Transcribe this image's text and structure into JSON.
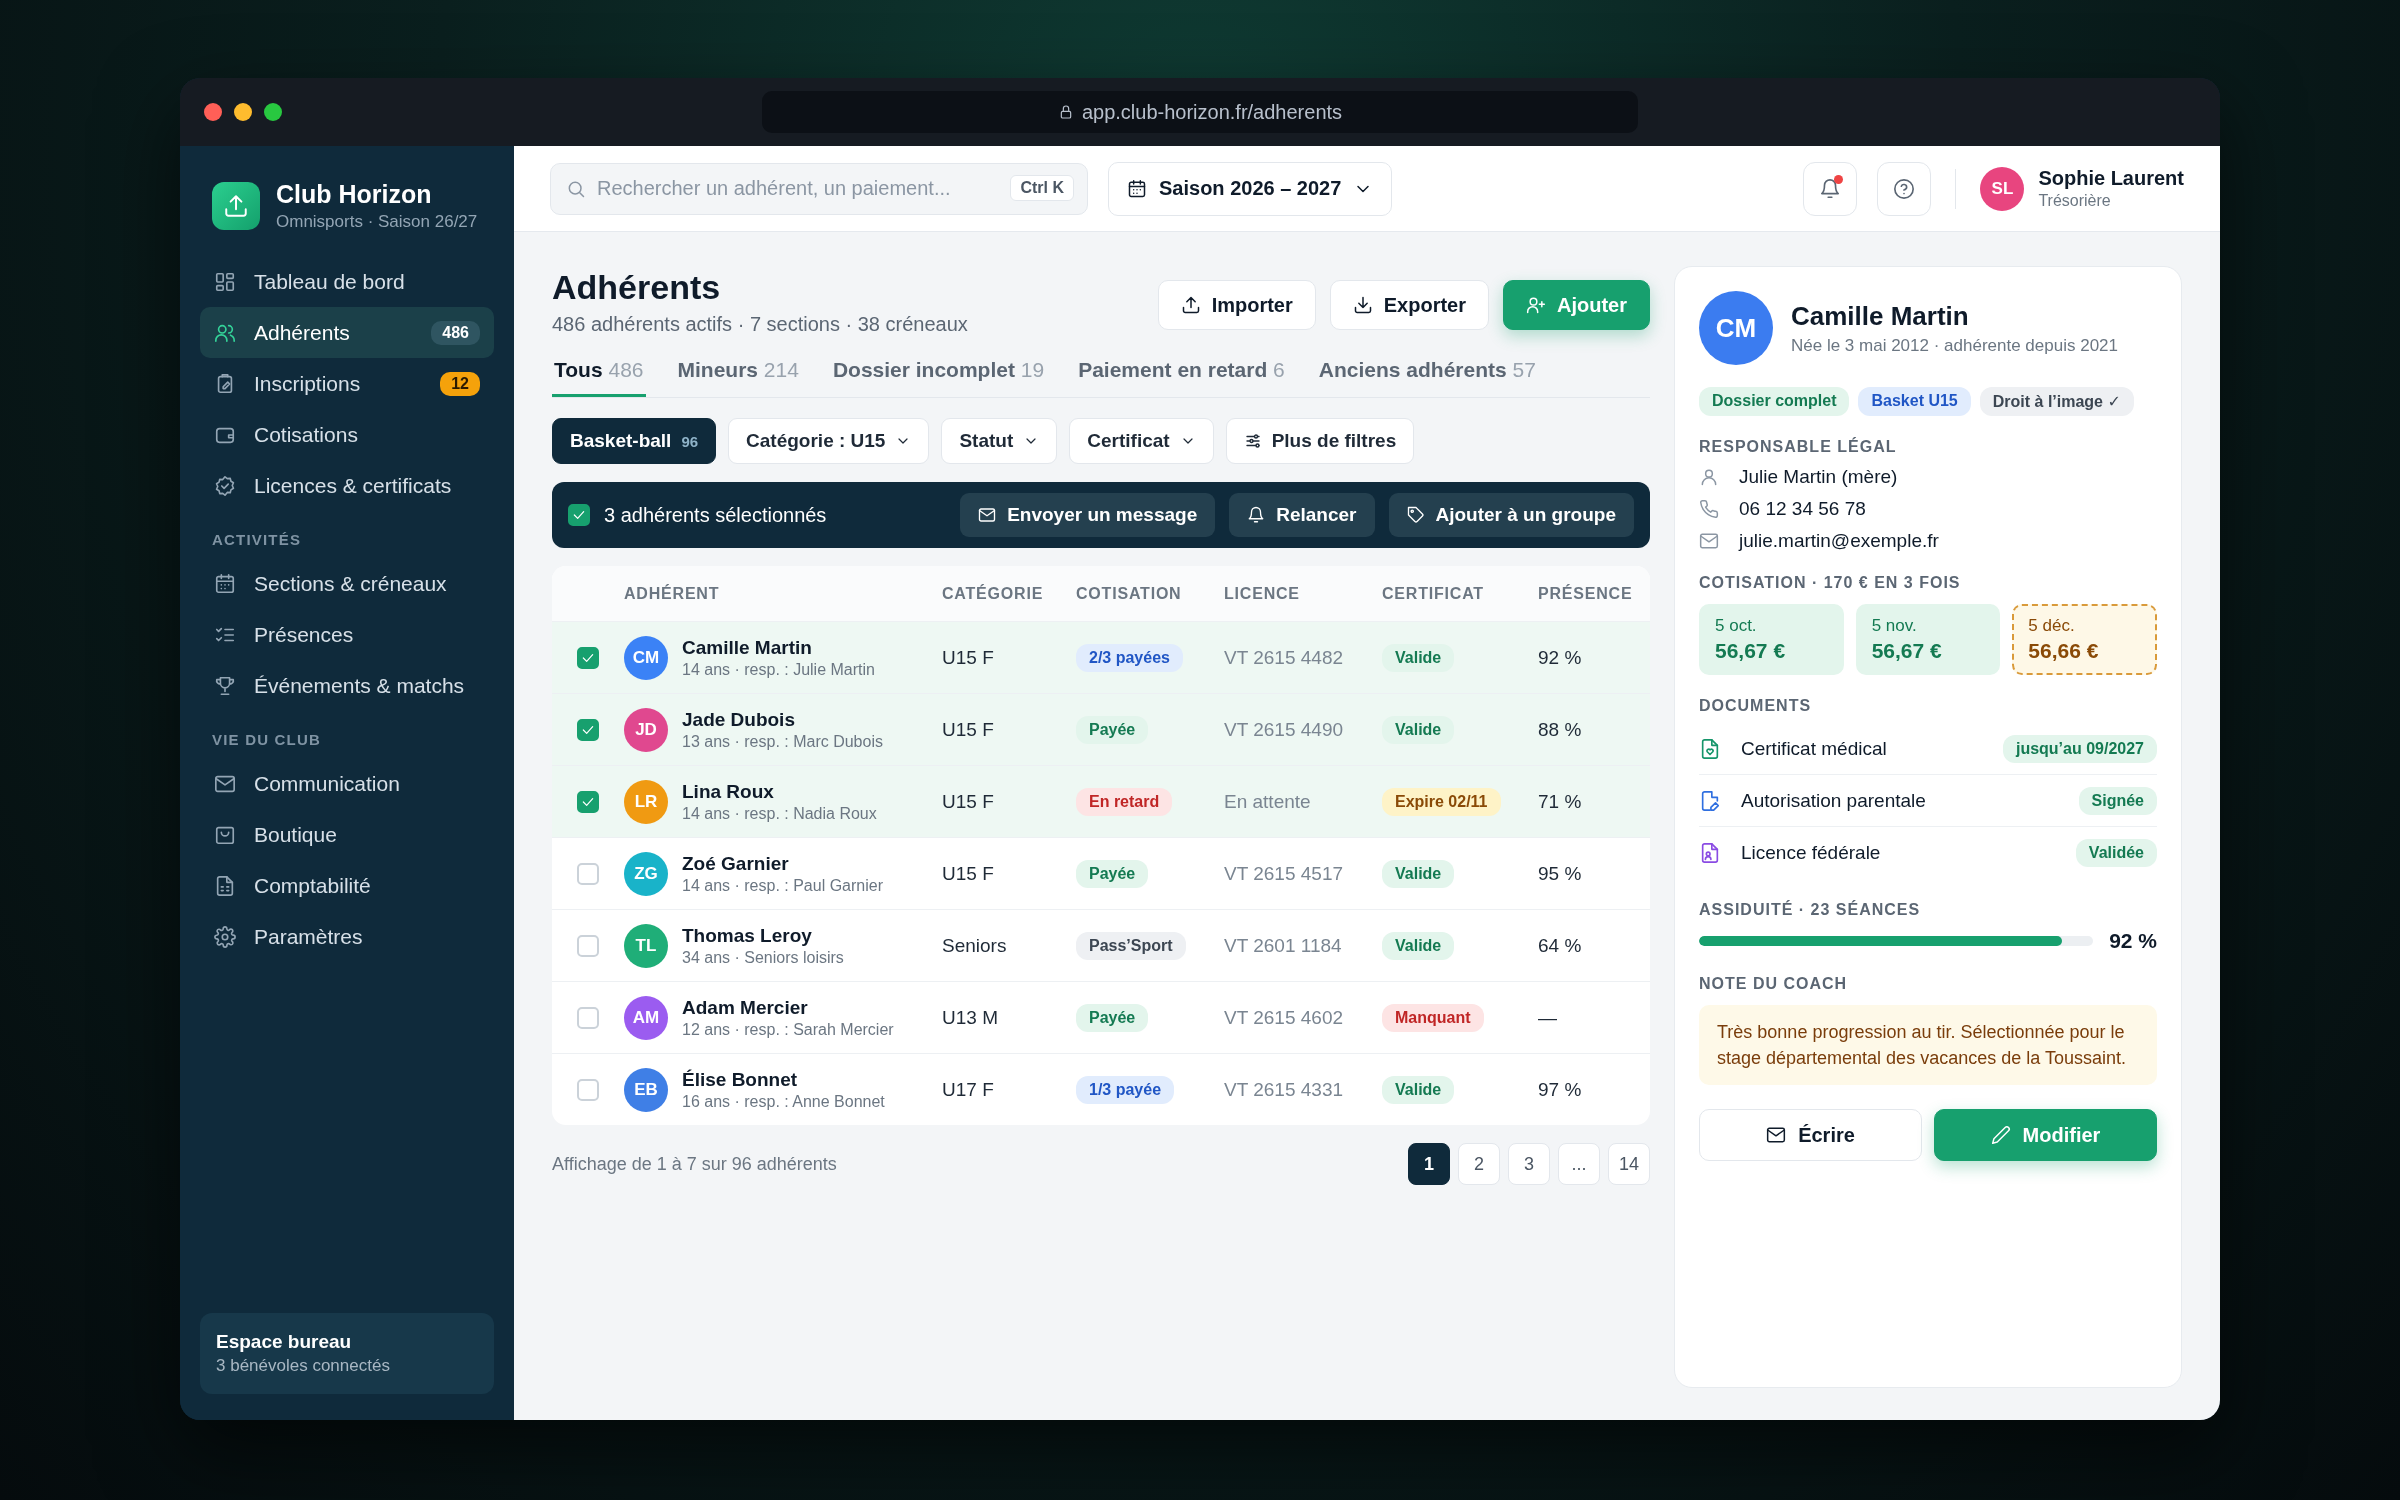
{
  "browser": {
    "url": "app.club-horizon.fr/adherents"
  },
  "sidebar": {
    "club_name": "Club Horizon",
    "club_subtitle": "Omnisports · Saison 26/27",
    "sections": [
      {
        "items": [
          {
            "label": "Tableau de bord",
            "selected": false
          },
          {
            "label": "Adhérents",
            "selected": true,
            "badge": {
              "text": "486",
              "kind": "neutral"
            }
          },
          {
            "label": "Inscriptions",
            "selected": false,
            "badge": {
              "text": "12",
              "kind": "warning"
            }
          },
          {
            "label": "Cotisations",
            "selected": false
          },
          {
            "label": "Licences & certificats",
            "selected": false
          }
        ]
      },
      {
        "heading": "ACTIVITÉS",
        "items": [
          {
            "label": "Sections & créneaux",
            "selected": false
          },
          {
            "label": "Présences",
            "selected": false
          },
          {
            "label": "Événements & matchs",
            "selected": false
          }
        ]
      },
      {
        "heading": "VIE DU CLUB",
        "items": [
          {
            "label": "Communication",
            "selected": false
          },
          {
            "label": "Boutique",
            "selected": false
          },
          {
            "label": "Comptabilité",
            "selected": false
          },
          {
            "label": "Paramètres",
            "selected": false
          }
        ]
      }
    ],
    "footer": {
      "title": "Espace bureau",
      "subtitle": "3 bénévoles connectés"
    }
  },
  "topbar": {
    "search": {
      "placeholder": "Rechercher un adhérent, un paiement...",
      "shortcut": "Ctrl K"
    },
    "season": "Saison 2026 – 2027",
    "notifications_unread": true,
    "user": {
      "initials": "SL",
      "color": "#e8457f",
      "name": "Sophie Laurent",
      "role": "Trésorière"
    }
  },
  "page": {
    "title": "Adhérents",
    "subtitle": "486 adhérents actifs · 7 sections · 38 créneaux",
    "actions": [
      {
        "label": "Importer",
        "kind": "import"
      },
      {
        "label": "Exporter",
        "kind": "export"
      },
      {
        "label": "Ajouter",
        "kind": "add"
      }
    ]
  },
  "tabs": [
    {
      "label": "Tous",
      "count": "486",
      "selected": true
    },
    {
      "label": "Mineurs",
      "count": "214",
      "selected": false
    },
    {
      "label": "Dossier incomplet",
      "count": "19",
      "selected": false
    },
    {
      "label": "Paiement en retard",
      "count": "6",
      "selected": false
    },
    {
      "label": "Anciens adhérents",
      "count": "57",
      "selected": false
    }
  ],
  "filters": [
    {
      "label": "Basket-ball",
      "count": "96",
      "kind": "chip",
      "selected": true
    },
    {
      "label": "Catégorie : U15",
      "kind": "dropdown",
      "selected": false
    },
    {
      "label": "Statut",
      "kind": "dropdown",
      "selected": false
    },
    {
      "label": "Certificat",
      "kind": "dropdown",
      "selected": false
    },
    {
      "label": "Plus de filtres",
      "kind": "more",
      "selected": false
    }
  ],
  "selection_bar": {
    "checked": true,
    "text": "3 adhérents sélectionnés",
    "actions": [
      {
        "label": "Envoyer un message",
        "kind": "message"
      },
      {
        "label": "Relancer",
        "kind": "remind"
      },
      {
        "label": "Ajouter à un groupe",
        "kind": "group"
      }
    ]
  },
  "table": {
    "columns": [
      "ADHÉRENT",
      "CATÉGORIE",
      "COTISATION",
      "LICENCE",
      "CERTIFICAT",
      "PRÉSENCE"
    ],
    "rows": [
      {
        "selected": true,
        "initials": "CM",
        "color": "#3b82f6",
        "name": "Camille Martin",
        "detail": "14 ans · resp. : Julie Martin",
        "category": "U15 F",
        "cotisation": {
          "text": "2/3 payées",
          "kind": "info"
        },
        "licence": "VT 2615 4482",
        "certificat": {
          "text": "Valide",
          "kind": "success"
        },
        "presence": "92 %"
      },
      {
        "selected": true,
        "initials": "JD",
        "color": "#e0488f",
        "name": "Jade Dubois",
        "detail": "13 ans · resp. : Marc Dubois",
        "category": "U15 F",
        "cotisation": {
          "text": "Payée",
          "kind": "success"
        },
        "licence": "VT 2615 4490",
        "certificat": {
          "text": "Valide",
          "kind": "success"
        },
        "presence": "88 %"
      },
      {
        "selected": true,
        "initials": "LR",
        "color": "#f09a12",
        "name": "Lina Roux",
        "detail": "14 ans · resp. : Nadia Roux",
        "category": "U15 F",
        "cotisation": {
          "text": "En retard",
          "kind": "danger"
        },
        "licence": "En attente",
        "certificat": {
          "text": "Expire 02/11",
          "kind": "warning"
        },
        "presence": "71 %"
      },
      {
        "selected": false,
        "initials": "ZG",
        "color": "#19b3c9",
        "name": "Zoé Garnier",
        "detail": "14 ans · resp. : Paul Garnier",
        "category": "U15 F",
        "cotisation": {
          "text": "Payée",
          "kind": "success"
        },
        "licence": "VT 2615 4517",
        "certificat": {
          "text": "Valide",
          "kind": "success"
        },
        "presence": "95 %"
      },
      {
        "selected": false,
        "initials": "TL",
        "color": "#1fae78",
        "name": "Thomas Leroy",
        "detail": "34 ans · Seniors loisirs",
        "category": "Seniors",
        "cotisation": {
          "text": "Pass’Sport",
          "kind": "neutral"
        },
        "licence": "VT 2601 1184",
        "certificat": {
          "text": "Valide",
          "kind": "success"
        },
        "presence": "64 %"
      },
      {
        "selected": false,
        "initials": "AM",
        "color": "#9b5cf0",
        "name": "Adam Mercier",
        "detail": "12 ans · resp. : Sarah Mercier",
        "category": "U13 M",
        "cotisation": {
          "text": "Payée",
          "kind": "success"
        },
        "licence": "VT 2615 4602",
        "certificat": {
          "text": "Manquant",
          "kind": "danger"
        },
        "presence": "—"
      },
      {
        "selected": false,
        "initials": "EB",
        "color": "#3f7fe6",
        "name": "Élise Bonnet",
        "detail": "16 ans · resp. : Anne Bonnet",
        "category": "U17 F",
        "cotisation": {
          "text": "1/3 payée",
          "kind": "info"
        },
        "licence": "VT 2615 4331",
        "certificat": {
          "text": "Valide",
          "kind": "success"
        },
        "presence": "97 %"
      }
    ]
  },
  "pagination": {
    "summary": "Affichage de 1 à 7 sur 96 adhérents",
    "pages": [
      {
        "label": "1",
        "selected": true
      },
      {
        "label": "2",
        "selected": false
      },
      {
        "label": "3",
        "selected": false
      },
      {
        "label": "...",
        "selected": false
      },
      {
        "label": "14",
        "selected": false
      }
    ]
  },
  "detail": {
    "initials": "CM",
    "color": "#3b7cf0",
    "name": "Camille Martin",
    "subtitle": "Née le 3 mai 2012 · adhérente depuis 2021",
    "tags": [
      {
        "text": "Dossier complet",
        "kind": "success"
      },
      {
        "text": "Basket U15",
        "kind": "info"
      },
      {
        "text": "Droit à l’image ✓",
        "kind": "neutral"
      }
    ],
    "guardian_heading": "RESPONSABLE LÉGAL",
    "guardian": [
      {
        "text": "Julie Martin (mère)",
        "kind": "person"
      },
      {
        "text": "06 12 34 56 78",
        "kind": "phone"
      },
      {
        "text": "julie.martin@exemple.fr",
        "kind": "email"
      }
    ],
    "payment_heading": "COTISATION · 170 € EN 3 FOIS",
    "installments": [
      {
        "date": "5 oct.",
        "amount": "56,67 €",
        "kind": "paid"
      },
      {
        "date": "5 nov.",
        "amount": "56,67 €",
        "kind": "paid"
      },
      {
        "date": "5 déc.",
        "amount": "56,66 €",
        "kind": "due"
      }
    ],
    "documents_heading": "DOCUMENTS",
    "documents": [
      {
        "label": "Certificat médical",
        "status": "jusqu’au 09/2027",
        "kind": "medical"
      },
      {
        "label": "Autorisation parentale",
        "status": "Signée",
        "kind": "signature"
      },
      {
        "label": "Licence fédérale",
        "status": "Validée",
        "kind": "licence"
      }
    ],
    "attendance": {
      "heading": "ASSIDUITÉ · 23 SÉANCES",
      "level": 0.92,
      "reading": "92 %"
    },
    "note_heading": "NOTE DU COACH",
    "note": "Très bonne progression au tir. Sélectionnée pour le stage départemental des vacances de la Toussaint.",
    "buttons": [
      {
        "label": "Écrire",
        "kind": "secondary"
      },
      {
        "label": "Modifier",
        "kind": "primary"
      }
    ]
  }
}
